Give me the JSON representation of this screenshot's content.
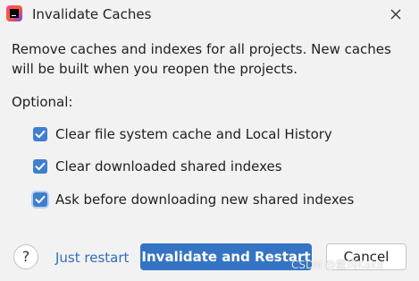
{
  "dialog": {
    "title": "Invalidate Caches",
    "app_icon": "intellij-idea-icon",
    "close_icon": "close-icon",
    "message": "Remove caches and indexes for all projects. New caches will be built when you reopen the projects.",
    "optional_label": "Optional:"
  },
  "options": [
    {
      "label": "Clear file system cache and Local History",
      "checked": true
    },
    {
      "label": "Clear downloaded shared indexes",
      "checked": true
    },
    {
      "label": "Ask before downloading new shared indexes",
      "checked": true
    }
  ],
  "footer": {
    "help_label": "?",
    "just_restart_label": "Just restart",
    "invalidate_label": "Invalidate and Restart",
    "cancel_label": "Cancel"
  },
  "watermark": "CSDN @戴玛Kaka",
  "colors": {
    "accent": "#3574c4",
    "checkbox": "#3e7fcf",
    "link": "#2f6fb8",
    "background": "#f2f2f2"
  }
}
